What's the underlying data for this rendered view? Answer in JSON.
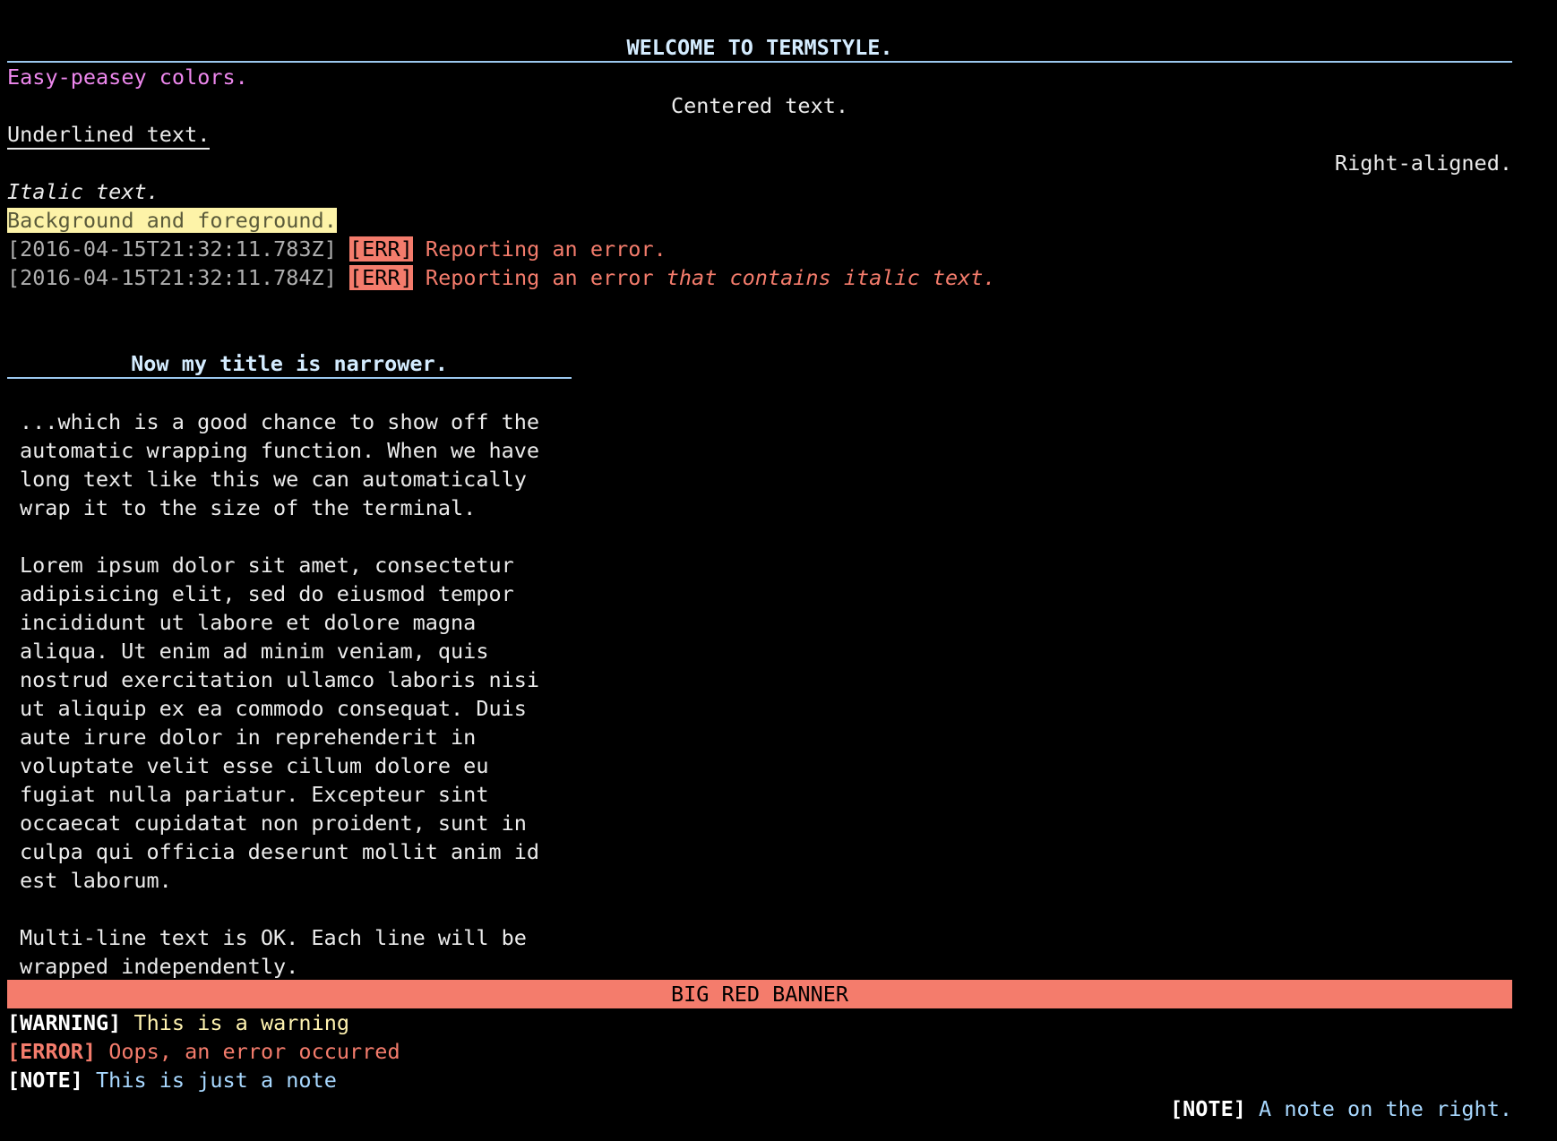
{
  "title": "WELCOME TO TERMSTYLE.",
  "easy": "Easy-peasey colors.",
  "centered": "Centered text.",
  "underlined": "Underlined text.",
  "right_aligned": "Right-aligned.",
  "italic": "Italic text.",
  "bg_fg": "Background and foreground.",
  "log": [
    {
      "timestamp": "[2016-04-15T21:32:11.783Z]",
      "tag": "[ERR]",
      "message": "Reporting an error.",
      "italic": ""
    },
    {
      "timestamp": "[2016-04-15T21:32:11.784Z]",
      "tag": "[ERR]",
      "message": "Reporting an error ",
      "italic": "that contains italic text."
    }
  ],
  "narrow_title": "Now my title is narrower.",
  "wrapped_text": "...which is a good chance to show off the\nautomatic wrapping function. When we have\nlong text like this we can automatically\nwrap it to the size of the terminal.\n\nLorem ipsum dolor sit amet, consectetur\nadipisicing elit, sed do eiusmod tempor\nincididunt ut labore et dolore magna\naliqua. Ut enim ad minim veniam, quis\nnostrud exercitation ullamco laboris nisi\nut aliquip ex ea commodo consequat. Duis\naute irure dolor in reprehenderit in\nvoluptate velit esse cillum dolore eu\nfugiat nulla pariatur. Excepteur sint\noccaecat cupidatat non proident, sunt in\nculpa qui officia deserunt mollit anim id\nest laborum.\n\nMulti-line text is OK. Each line will be\nwrapped independently.",
  "banner": "BIG RED BANNER",
  "warning": {
    "tag": "[WARNING]",
    "text": " This is a warning"
  },
  "error": {
    "tag": "[ERROR]",
    "text": " Oops, an error occurred"
  },
  "note": {
    "tag": "[NOTE]",
    "text": " This is just a note"
  },
  "note_right": {
    "tag": "[NOTE]",
    "text": " A note on the right."
  },
  "colors": {
    "background": "#000000",
    "title": "#d4ecff",
    "easy": "#ee88ee",
    "error": "#f47c6c",
    "highlight_bg": "#fdf3a8",
    "note": "#a8d8ff"
  }
}
